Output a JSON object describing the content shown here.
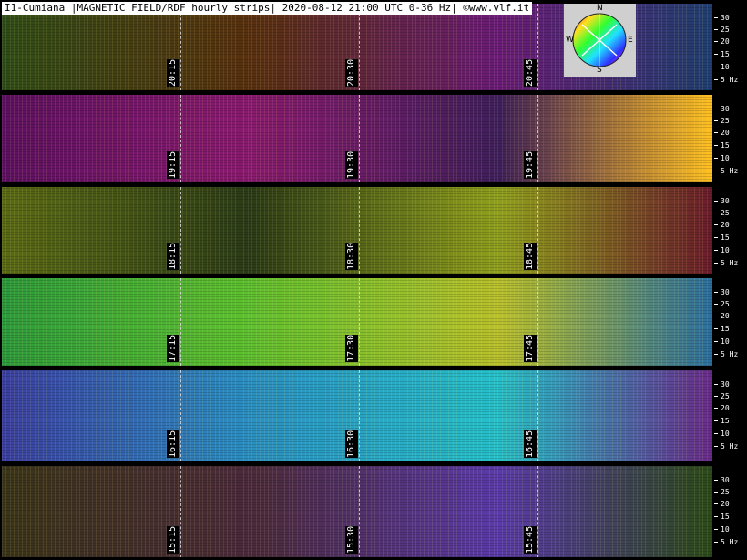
{
  "header": {
    "title": "I1-Cumiana |MAGNETIC FIELD/RDF hourly strips| 2020-08-12 21:00 UTC 0-36 Hz| ©www.vlf.it"
  },
  "compass": {
    "north": "N",
    "south": "S",
    "east": "E",
    "west": "W"
  },
  "axis_ticks": [
    "30",
    "25",
    "20",
    "15",
    "10",
    "5 Hz"
  ],
  "strips": [
    {
      "labels": [
        "20:15",
        "20:30",
        "20:45"
      ],
      "colors": [
        "#2f4d16",
        "#59300e",
        "#6b1b76",
        "#1f3f70"
      ]
    },
    {
      "labels": [
        "19:15",
        "19:30",
        "19:45"
      ],
      "colors": [
        "#5d1060",
        "#8a1a6e",
        "#3f1f5a",
        "#ffc020"
      ]
    },
    {
      "labels": [
        "18:15",
        "18:30",
        "18:45"
      ],
      "colors": [
        "#5a6a14",
        "#2b3b16",
        "#8f9f1c",
        "#6a1b2a"
      ]
    },
    {
      "labels": [
        "17:15",
        "17:30",
        "17:45"
      ],
      "colors": [
        "#2c9a3a",
        "#5fc02e",
        "#b9c02a",
        "#2a6fa0"
      ]
    },
    {
      "labels": [
        "16:15",
        "16:30",
        "16:45"
      ],
      "colors": [
        "#3b3ea0",
        "#2a8fc0",
        "#26c0c8",
        "#6a2a8a"
      ]
    },
    {
      "labels": [
        "15:15",
        "15:30",
        "15:45"
      ],
      "colors": [
        "#3a3418",
        "#4b2a3a",
        "#5a3aa8",
        "#2b4a18"
      ]
    }
  ]
}
